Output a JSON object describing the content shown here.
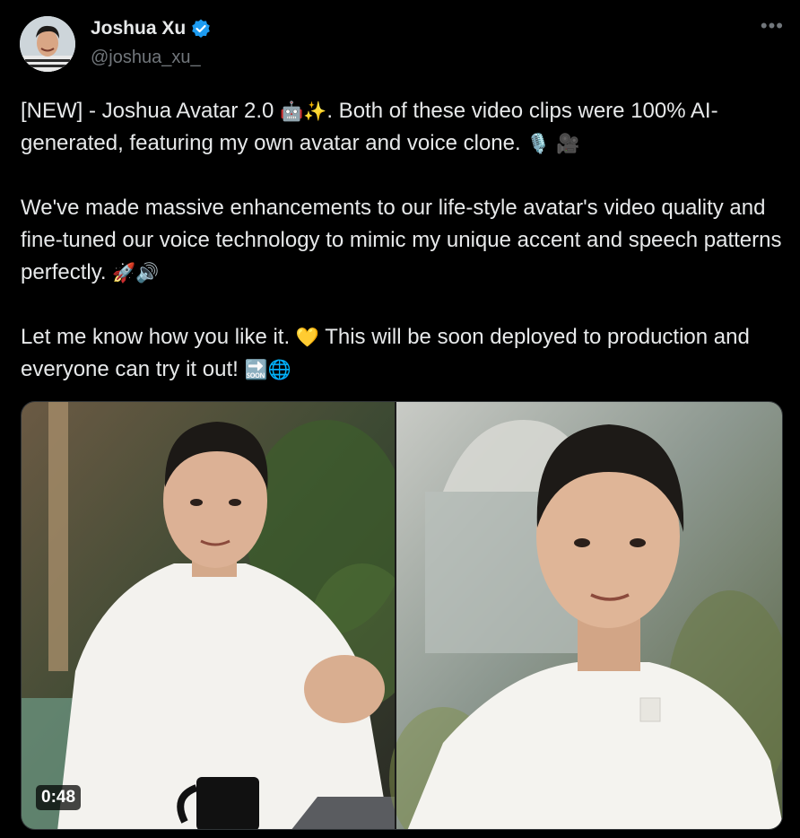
{
  "author": {
    "name": "Joshua Xu",
    "handle": "@joshua_xu_",
    "verified": true
  },
  "more_icon": "more-horizontal-icon",
  "paragraphs": [
    {
      "segments": [
        {
          "t": "[NEW] - Joshua Avatar 2.0 "
        },
        {
          "t": "🤖",
          "emoji": true,
          "icon": "robot-emoji"
        },
        {
          "t": "✨",
          "emoji": true,
          "icon": "sparkles-emoji"
        },
        {
          "t": ". Both of these video clips were 100% AI-generated, featuring my own avatar and voice clone. "
        },
        {
          "t": "🎙️",
          "emoji": true,
          "icon": "microphone-emoji"
        },
        {
          "t": " "
        },
        {
          "t": "🎥",
          "emoji": true,
          "icon": "movie-camera-emoji"
        }
      ]
    },
    {
      "segments": [
        {
          "t": "We've made massive enhancements to our life-style avatar's video quality and fine-tuned our voice technology to mimic my unique accent and speech patterns perfectly. "
        },
        {
          "t": "🚀",
          "emoji": true,
          "icon": "rocket-emoji"
        },
        {
          "t": "🔊",
          "emoji": true,
          "icon": "speaker-emoji"
        }
      ]
    },
    {
      "segments": [
        {
          "t": "Let me know how you like it. "
        },
        {
          "t": "💛",
          "emoji": true,
          "icon": "yellow-heart-emoji"
        },
        {
          "t": " This will be soon deployed to production and everyone can try it out! "
        },
        {
          "t": "🔜",
          "emoji": true,
          "icon": "soon-arrow-emoji"
        },
        {
          "t": "🌐",
          "emoji": true,
          "icon": "globe-emoji"
        }
      ]
    }
  ],
  "media": {
    "duration": "0:48",
    "left_frame": "avatar-video-frame-desk",
    "right_frame": "avatar-video-frame-closeup"
  },
  "colors": {
    "background": "#000000",
    "text": "#e7e9ea",
    "secondary": "#71767b",
    "verified": "#1d9bf0"
  }
}
